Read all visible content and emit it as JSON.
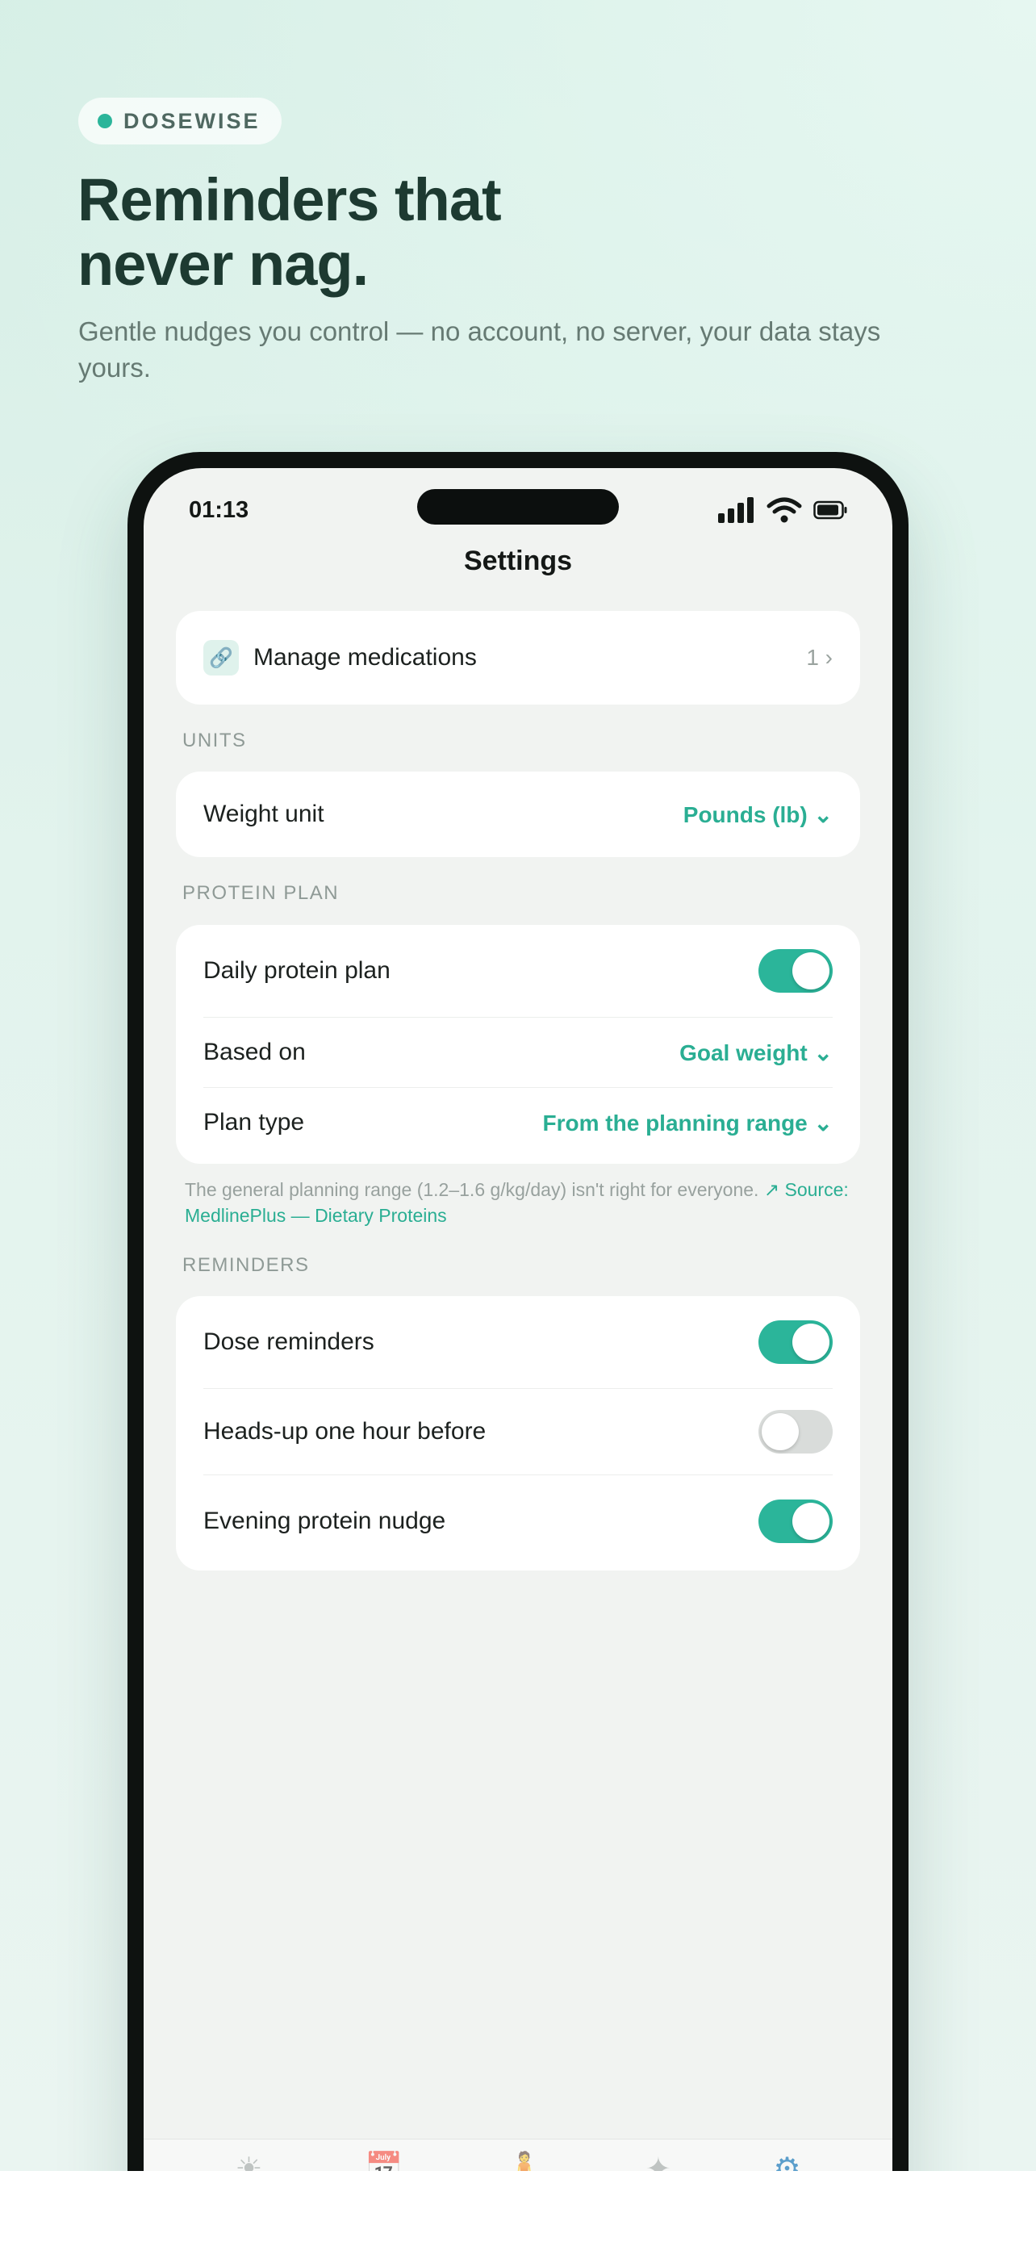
{
  "promo": {
    "brand": "DOSEWISE",
    "headline_line1": "Reminders that",
    "headline_line2": "never nag.",
    "subheadline": "Gentle nudges you control — no account, no server, your data stays yours."
  },
  "status_bar": {
    "time": "01:13"
  },
  "screen": {
    "title": "Settings"
  },
  "medications": {
    "label": "Manage medications",
    "count": "1",
    "chevron": "›",
    "icon": "link-icon"
  },
  "units": {
    "header": "UNITS",
    "weight_unit_label": "Weight unit",
    "weight_unit_value": "Pounds (lb)",
    "chevron": "⌄"
  },
  "protein_plan": {
    "header": "PROTEIN PLAN",
    "daily_label": "Daily protein plan",
    "daily_on": true,
    "based_on_label": "Based on",
    "based_on_value": "Goal weight",
    "plan_type_label": "Plan type",
    "plan_type_value": "From the planning range",
    "footnote": "The general planning range (1.2–1.6 g/kg/day) isn't right for everyone.",
    "source_link": "↗ Source: MedlinePlus — Dietary Proteins"
  },
  "reminders": {
    "header": "REMINDERS",
    "items": [
      {
        "label": "Dose reminders",
        "on": true
      },
      {
        "label": "Heads-up one hour before",
        "on": false
      },
      {
        "label": "Evening protein nudge",
        "on": true
      }
    ]
  },
  "tabbar": {
    "tabs": [
      "sun-icon",
      "calendar-icon",
      "person-icon",
      "sparkle-icon",
      "gear-icon"
    ],
    "active": "gear-icon"
  },
  "colors": {
    "accent": "#2bb59a",
    "headline": "#1d3a31",
    "toggle_off": "#d9dcda"
  }
}
